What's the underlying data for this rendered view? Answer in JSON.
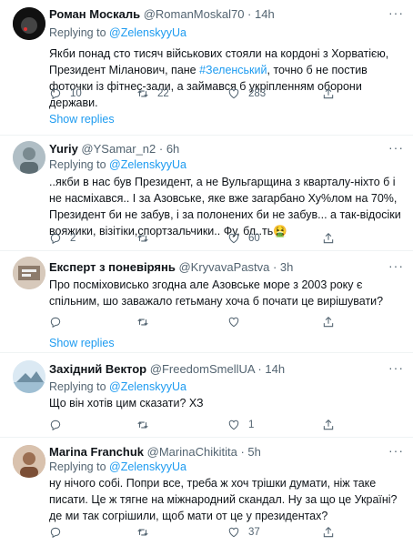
{
  "tweets": [
    {
      "name": "Роман Москаль",
      "handle": "@RomanMoskal70 · 14h",
      "replying_prefix": "Replying to",
      "replying_to": "@ZelenskyyUa",
      "text_1": "Якби понад сто тисяч військових стояли на кордоні з Хорватією, Президент Міланович, пане ",
      "hashtag": "#Зеленський",
      "text_2": ", точно б не постив фоточки із фітнес-зали, а займався б укріпленням оборони держави.",
      "replies": "10",
      "retweets": "22",
      "likes": "283",
      "show_replies": "Show replies"
    },
    {
      "name": "Yuriy",
      "handle": "@YSamar_n2 · 6h",
      "replying_prefix": "Replying to",
      "replying_to": "@ZelenskyyUa",
      "text": "..якби в нас був Президент, а не Вульгарщина з кварталу-ніхто б і не насміхався.. І за Азовське, яке вже загарбано Ху%лом на 70%, Президент би не забув, і за полонених би не забув... а так-відосіки вояжики, візітіки,спортзальчики.. Фу, бл..ть🤮",
      "replies": "2",
      "retweets": "",
      "likes": "60"
    },
    {
      "name": "Експерт з поневірянь",
      "handle": "@KryvavaPastva · 3h",
      "text": "Про посміховисько згодна  але Азовське море з 2003 року є спільним, шо заважало гетьману хоча б почати це вирішувати?",
      "replies": "",
      "retweets": "",
      "likes": "",
      "show_replies": "Show replies"
    },
    {
      "name": "Західний Вектор",
      "handle": "@FreedomSmellUA · 14h",
      "replying_prefix": "Replying to",
      "replying_to": "@ZelenskyyUa",
      "text": "Що він хотів цим сказати? ХЗ",
      "replies": "",
      "retweets": "",
      "likes": "1"
    },
    {
      "name": "Marina Franchuk",
      "handle": "@MarinaChikitita · 5h",
      "replying_prefix": "Replying to",
      "replying_to": "@ZelenskyyUa",
      "text": "ну нічого собі. Попри все, треба ж хоч трішки думати, ніж таке писати. Це ж тягне на міжнародний скандал. Ну за що це Україні? де ми так согрішили, щоб мати от це у президентах?",
      "replies": "",
      "retweets": "",
      "likes": "37"
    }
  ],
  "more_glyph": "···",
  "colors": {
    "accent": "#1d9bf0",
    "secondary": "#536471",
    "divider": "#eff3f4"
  },
  "icons": [
    "reply-icon",
    "retweet-icon",
    "like-icon",
    "share-icon",
    "more-icon"
  ]
}
